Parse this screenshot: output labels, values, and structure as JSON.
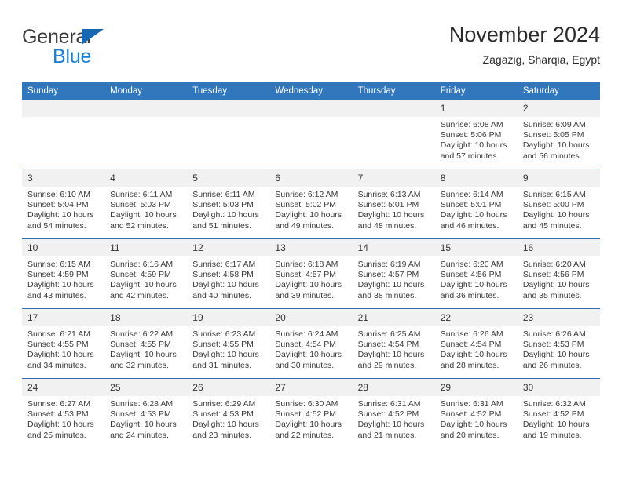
{
  "brand": {
    "line1": "General",
    "line2": "Blue",
    "flag_icon": "blue-triangle-flag",
    "accent_color": "#1b7fd4",
    "flag_color": "#1668b3"
  },
  "header": {
    "title": "November 2024",
    "subtitle": "Zagazig, Sharqia, Egypt"
  },
  "theme": {
    "header_row_bg": "#3277bc",
    "header_row_text": "#ffffff",
    "daynum_bg": "#f1f1f1",
    "row_divider": "#2f6fb0",
    "body_text": "#3a3a3a"
  },
  "weekday_headers": [
    "Sunday",
    "Monday",
    "Tuesday",
    "Wednesday",
    "Thursday",
    "Friday",
    "Saturday"
  ],
  "weeks": [
    [
      {
        "day": "",
        "empty": true,
        "sunrise": "",
        "sunset": "",
        "daylight_line1": "",
        "daylight_line2": ""
      },
      {
        "day": "",
        "empty": true,
        "sunrise": "",
        "sunset": "",
        "daylight_line1": "",
        "daylight_line2": ""
      },
      {
        "day": "",
        "empty": true,
        "sunrise": "",
        "sunset": "",
        "daylight_line1": "",
        "daylight_line2": ""
      },
      {
        "day": "",
        "empty": true,
        "sunrise": "",
        "sunset": "",
        "daylight_line1": "",
        "daylight_line2": ""
      },
      {
        "day": "",
        "empty": true,
        "sunrise": "",
        "sunset": "",
        "daylight_line1": "",
        "daylight_line2": ""
      },
      {
        "day": "1",
        "empty": false,
        "sunrise": "Sunrise: 6:08 AM",
        "sunset": "Sunset: 5:06 PM",
        "daylight_line1": "Daylight: 10 hours",
        "daylight_line2": "and 57 minutes."
      },
      {
        "day": "2",
        "empty": false,
        "sunrise": "Sunrise: 6:09 AM",
        "sunset": "Sunset: 5:05 PM",
        "daylight_line1": "Daylight: 10 hours",
        "daylight_line2": "and 56 minutes."
      }
    ],
    [
      {
        "day": "3",
        "empty": false,
        "sunrise": "Sunrise: 6:10 AM",
        "sunset": "Sunset: 5:04 PM",
        "daylight_line1": "Daylight: 10 hours",
        "daylight_line2": "and 54 minutes."
      },
      {
        "day": "4",
        "empty": false,
        "sunrise": "Sunrise: 6:11 AM",
        "sunset": "Sunset: 5:03 PM",
        "daylight_line1": "Daylight: 10 hours",
        "daylight_line2": "and 52 minutes."
      },
      {
        "day": "5",
        "empty": false,
        "sunrise": "Sunrise: 6:11 AM",
        "sunset": "Sunset: 5:03 PM",
        "daylight_line1": "Daylight: 10 hours",
        "daylight_line2": "and 51 minutes."
      },
      {
        "day": "6",
        "empty": false,
        "sunrise": "Sunrise: 6:12 AM",
        "sunset": "Sunset: 5:02 PM",
        "daylight_line1": "Daylight: 10 hours",
        "daylight_line2": "and 49 minutes."
      },
      {
        "day": "7",
        "empty": false,
        "sunrise": "Sunrise: 6:13 AM",
        "sunset": "Sunset: 5:01 PM",
        "daylight_line1": "Daylight: 10 hours",
        "daylight_line2": "and 48 minutes."
      },
      {
        "day": "8",
        "empty": false,
        "sunrise": "Sunrise: 6:14 AM",
        "sunset": "Sunset: 5:01 PM",
        "daylight_line1": "Daylight: 10 hours",
        "daylight_line2": "and 46 minutes."
      },
      {
        "day": "9",
        "empty": false,
        "sunrise": "Sunrise: 6:15 AM",
        "sunset": "Sunset: 5:00 PM",
        "daylight_line1": "Daylight: 10 hours",
        "daylight_line2": "and 45 minutes."
      }
    ],
    [
      {
        "day": "10",
        "empty": false,
        "sunrise": "Sunrise: 6:15 AM",
        "sunset": "Sunset: 4:59 PM",
        "daylight_line1": "Daylight: 10 hours",
        "daylight_line2": "and 43 minutes."
      },
      {
        "day": "11",
        "empty": false,
        "sunrise": "Sunrise: 6:16 AM",
        "sunset": "Sunset: 4:59 PM",
        "daylight_line1": "Daylight: 10 hours",
        "daylight_line2": "and 42 minutes."
      },
      {
        "day": "12",
        "empty": false,
        "sunrise": "Sunrise: 6:17 AM",
        "sunset": "Sunset: 4:58 PM",
        "daylight_line1": "Daylight: 10 hours",
        "daylight_line2": "and 40 minutes."
      },
      {
        "day": "13",
        "empty": false,
        "sunrise": "Sunrise: 6:18 AM",
        "sunset": "Sunset: 4:57 PM",
        "daylight_line1": "Daylight: 10 hours",
        "daylight_line2": "and 39 minutes."
      },
      {
        "day": "14",
        "empty": false,
        "sunrise": "Sunrise: 6:19 AM",
        "sunset": "Sunset: 4:57 PM",
        "daylight_line1": "Daylight: 10 hours",
        "daylight_line2": "and 38 minutes."
      },
      {
        "day": "15",
        "empty": false,
        "sunrise": "Sunrise: 6:20 AM",
        "sunset": "Sunset: 4:56 PM",
        "daylight_line1": "Daylight: 10 hours",
        "daylight_line2": "and 36 minutes."
      },
      {
        "day": "16",
        "empty": false,
        "sunrise": "Sunrise: 6:20 AM",
        "sunset": "Sunset: 4:56 PM",
        "daylight_line1": "Daylight: 10 hours",
        "daylight_line2": "and 35 minutes."
      }
    ],
    [
      {
        "day": "17",
        "empty": false,
        "sunrise": "Sunrise: 6:21 AM",
        "sunset": "Sunset: 4:55 PM",
        "daylight_line1": "Daylight: 10 hours",
        "daylight_line2": "and 34 minutes."
      },
      {
        "day": "18",
        "empty": false,
        "sunrise": "Sunrise: 6:22 AM",
        "sunset": "Sunset: 4:55 PM",
        "daylight_line1": "Daylight: 10 hours",
        "daylight_line2": "and 32 minutes."
      },
      {
        "day": "19",
        "empty": false,
        "sunrise": "Sunrise: 6:23 AM",
        "sunset": "Sunset: 4:55 PM",
        "daylight_line1": "Daylight: 10 hours",
        "daylight_line2": "and 31 minutes."
      },
      {
        "day": "20",
        "empty": false,
        "sunrise": "Sunrise: 6:24 AM",
        "sunset": "Sunset: 4:54 PM",
        "daylight_line1": "Daylight: 10 hours",
        "daylight_line2": "and 30 minutes."
      },
      {
        "day": "21",
        "empty": false,
        "sunrise": "Sunrise: 6:25 AM",
        "sunset": "Sunset: 4:54 PM",
        "daylight_line1": "Daylight: 10 hours",
        "daylight_line2": "and 29 minutes."
      },
      {
        "day": "22",
        "empty": false,
        "sunrise": "Sunrise: 6:26 AM",
        "sunset": "Sunset: 4:54 PM",
        "daylight_line1": "Daylight: 10 hours",
        "daylight_line2": "and 28 minutes."
      },
      {
        "day": "23",
        "empty": false,
        "sunrise": "Sunrise: 6:26 AM",
        "sunset": "Sunset: 4:53 PM",
        "daylight_line1": "Daylight: 10 hours",
        "daylight_line2": "and 26 minutes."
      }
    ],
    [
      {
        "day": "24",
        "empty": false,
        "sunrise": "Sunrise: 6:27 AM",
        "sunset": "Sunset: 4:53 PM",
        "daylight_line1": "Daylight: 10 hours",
        "daylight_line2": "and 25 minutes."
      },
      {
        "day": "25",
        "empty": false,
        "sunrise": "Sunrise: 6:28 AM",
        "sunset": "Sunset: 4:53 PM",
        "daylight_line1": "Daylight: 10 hours",
        "daylight_line2": "and 24 minutes."
      },
      {
        "day": "26",
        "empty": false,
        "sunrise": "Sunrise: 6:29 AM",
        "sunset": "Sunset: 4:53 PM",
        "daylight_line1": "Daylight: 10 hours",
        "daylight_line2": "and 23 minutes."
      },
      {
        "day": "27",
        "empty": false,
        "sunrise": "Sunrise: 6:30 AM",
        "sunset": "Sunset: 4:52 PM",
        "daylight_line1": "Daylight: 10 hours",
        "daylight_line2": "and 22 minutes."
      },
      {
        "day": "28",
        "empty": false,
        "sunrise": "Sunrise: 6:31 AM",
        "sunset": "Sunset: 4:52 PM",
        "daylight_line1": "Daylight: 10 hours",
        "daylight_line2": "and 21 minutes."
      },
      {
        "day": "29",
        "empty": false,
        "sunrise": "Sunrise: 6:31 AM",
        "sunset": "Sunset: 4:52 PM",
        "daylight_line1": "Daylight: 10 hours",
        "daylight_line2": "and 20 minutes."
      },
      {
        "day": "30",
        "empty": false,
        "sunrise": "Sunrise: 6:32 AM",
        "sunset": "Sunset: 4:52 PM",
        "daylight_line1": "Daylight: 10 hours",
        "daylight_line2": "and 19 minutes."
      }
    ]
  ]
}
